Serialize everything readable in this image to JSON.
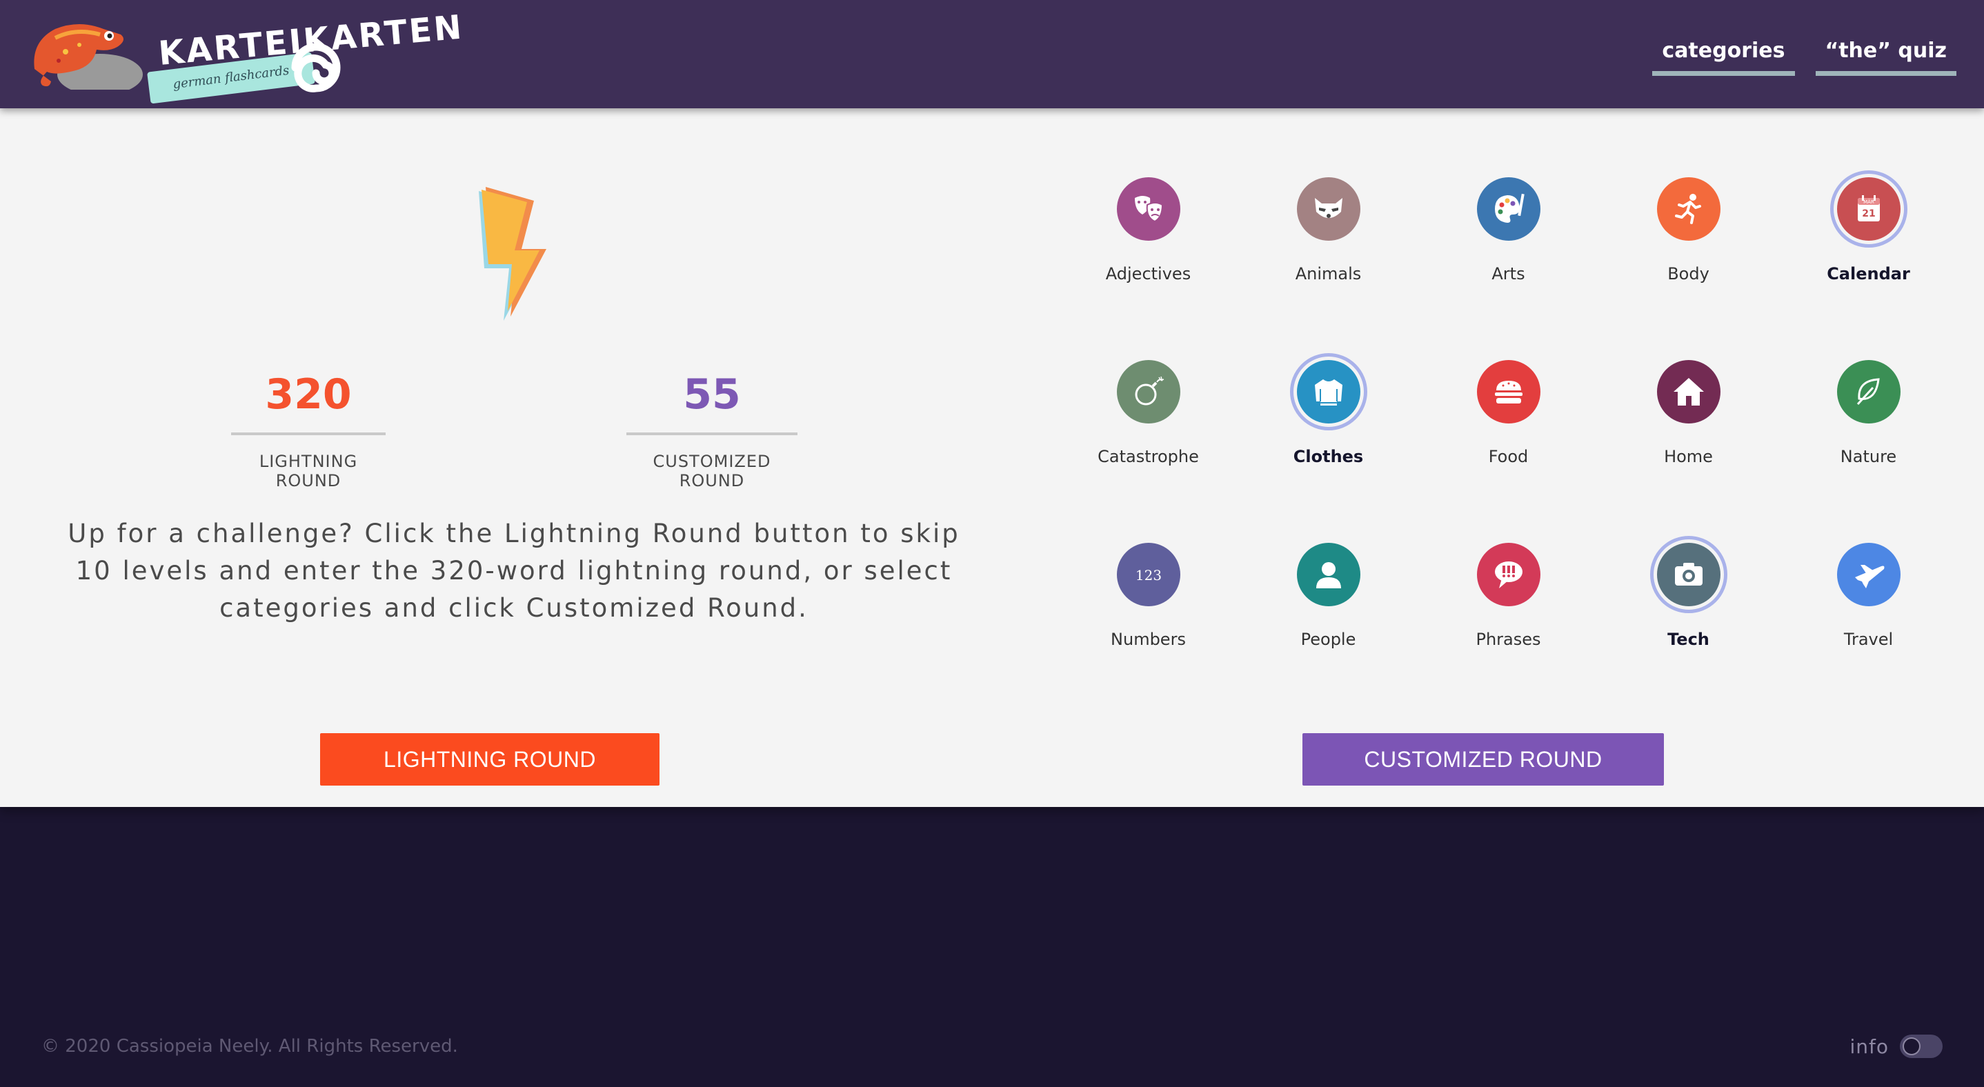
{
  "header": {
    "logo_title": "KARTEIKARTEN",
    "logo_subtitle": "german flashcards",
    "nav": [
      {
        "label": "categories"
      },
      {
        "label": "“the” quiz"
      }
    ]
  },
  "stats": {
    "lightning": {
      "value": "320",
      "label": "LIGHTNING ROUND"
    },
    "customized": {
      "value": "55",
      "label": "CUSTOMIZED ROUND"
    }
  },
  "description": "Up for a challenge? Click the Lightning Round button to skip 10 levels and enter the 320-word lightning round, or select categories and click Customized Round.",
  "buttons": {
    "lightning": "LIGHTNING ROUND",
    "customized": "CUSTOMIZED ROUND"
  },
  "categories": [
    {
      "label": "Adjectives",
      "color": "#a04d8b",
      "icon": "theater-masks-icon",
      "selected": false
    },
    {
      "label": "Animals",
      "color": "#a38283",
      "icon": "raccoon-icon",
      "selected": false
    },
    {
      "label": "Arts",
      "color": "#3c77b1",
      "icon": "palette-icon",
      "selected": false
    },
    {
      "label": "Body",
      "color": "#f36a3c",
      "icon": "running-person-icon",
      "selected": false
    },
    {
      "label": "Calendar",
      "color": "#c84f52",
      "icon": "calendar-icon",
      "selected": true,
      "icon_text": "MÄR",
      "icon_day": "21"
    },
    {
      "label": "Catastrophe",
      "color": "#6e8d70",
      "icon": "bomb-icon",
      "selected": false
    },
    {
      "label": "Clothes",
      "color": "#2792c4",
      "icon": "sweater-icon",
      "selected": true
    },
    {
      "label": "Food",
      "color": "#e33e3e",
      "icon": "burger-icon",
      "selected": false
    },
    {
      "label": "Home",
      "color": "#732b53",
      "icon": "house-icon",
      "selected": false
    },
    {
      "label": "Nature",
      "color": "#3b8f55",
      "icon": "leaf-icon",
      "selected": false
    },
    {
      "label": "Numbers",
      "color": "#5f5f9c",
      "icon": "numbers-icon",
      "selected": false,
      "icon_text": "123"
    },
    {
      "label": "People",
      "color": "#1e8a86",
      "icon": "person-icon",
      "selected": false
    },
    {
      "label": "Phrases",
      "color": "#d33a58",
      "icon": "speech-bubble-icon",
      "selected": false
    },
    {
      "label": "Tech",
      "color": "#56707c",
      "icon": "camera-icon",
      "selected": true
    },
    {
      "label": "Travel",
      "color": "#4d87e4",
      "icon": "airplane-icon",
      "selected": false
    }
  ],
  "footer": {
    "copyright": "© 2020 Cassiopeia Neely. All Rights Reserved.",
    "info_label": "info"
  }
}
